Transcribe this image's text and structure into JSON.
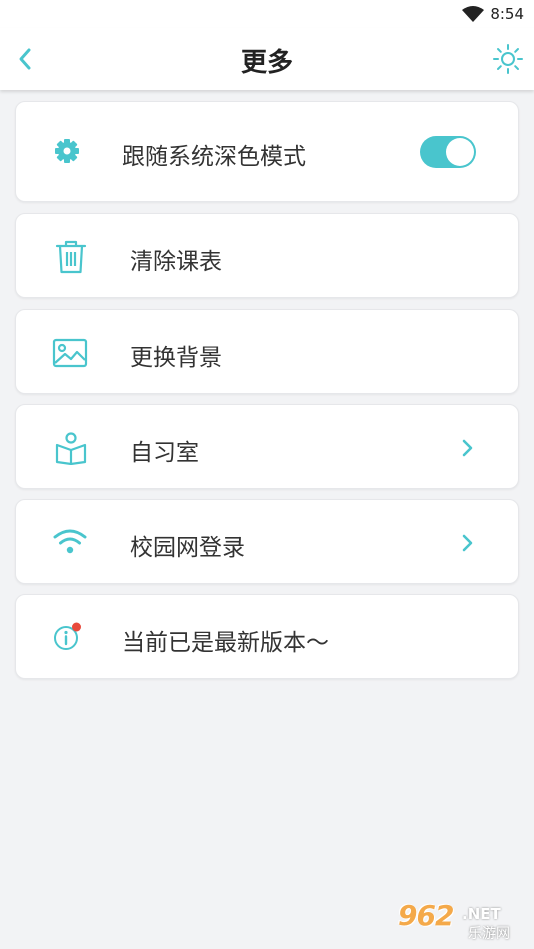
{
  "status_bar": {
    "time": "8:54"
  },
  "header": {
    "title": "更多"
  },
  "settings": {
    "dark_mode": {
      "label": "跟随系统深色模式",
      "enabled": true
    },
    "clear_schedule": {
      "label": "清除课表"
    },
    "change_background": {
      "label": "更换背景"
    },
    "study_room": {
      "label": "自习室"
    },
    "campus_login": {
      "label": "校园网登录"
    },
    "version": {
      "label": "当前已是最新版本～"
    }
  },
  "watermark": {
    "main": "962",
    "net": ".NET",
    "sub": "乐游网"
  },
  "colors": {
    "accent": "#49c5cd",
    "background": "#f2f3f5",
    "card": "#ffffff",
    "badge_red": "#e84a3c"
  }
}
